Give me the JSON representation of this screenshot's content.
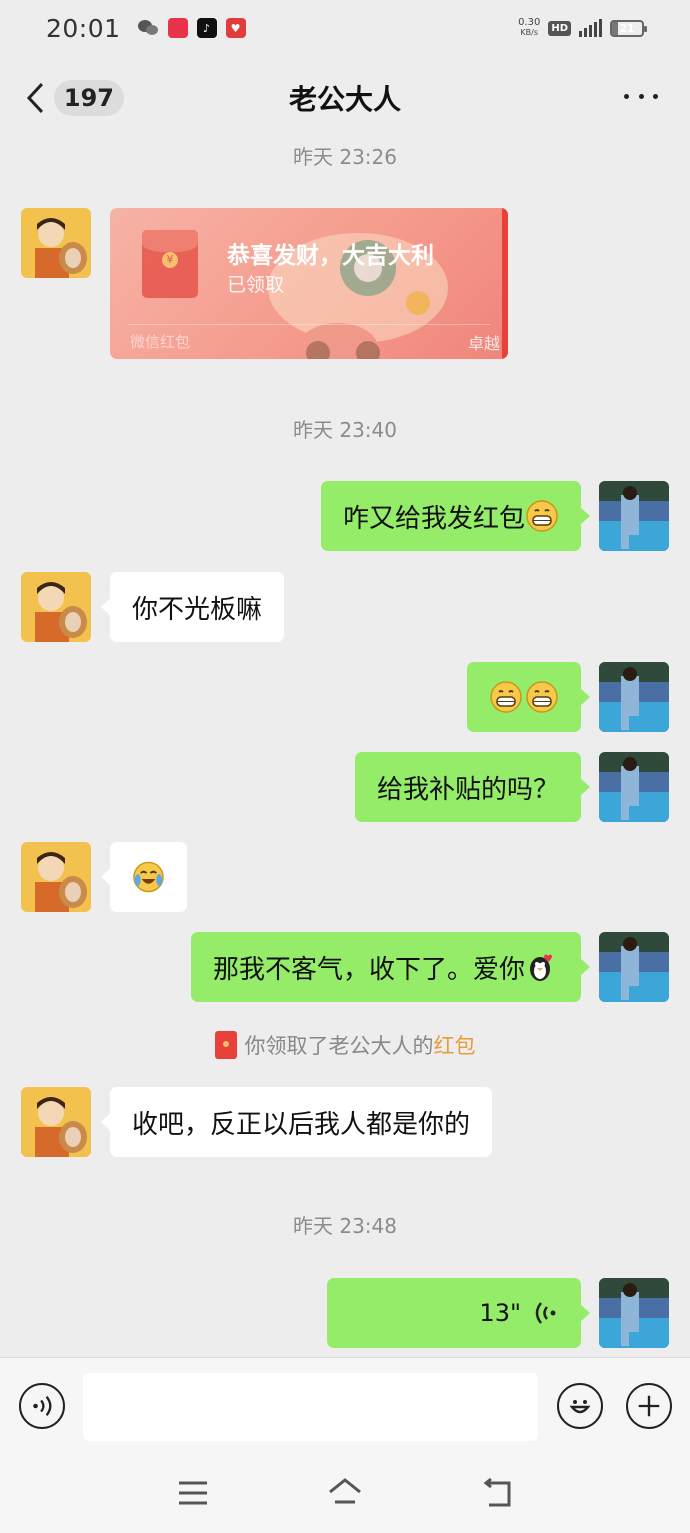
{
  "status_bar": {
    "time": "20:01",
    "network_speed": "0.30",
    "network_unit": "KB/s",
    "hd_label": "HD",
    "signal_label": "5G",
    "battery": "21"
  },
  "header": {
    "unread_count": "197",
    "title": "老公大人"
  },
  "timestamps": [
    "昨天 23:26",
    "昨天 23:40",
    "昨天 23:48"
  ],
  "red_packet": {
    "title": "恭喜发财，大吉大利",
    "status": "已领取",
    "footer_left": "微信红包",
    "footer_right": "卓越"
  },
  "messages": {
    "m1": "咋又给我发红包",
    "m2": "你不光板嘛",
    "m4": "给我补贴的吗？",
    "m6": "那我不客气，收下了。爱你",
    "m7": "收吧，反正以后我人都是你的"
  },
  "system_message": {
    "prefix": "你领取了老公大人的",
    "link": "红包"
  },
  "voice": {
    "duration": "13\""
  },
  "colors": {
    "sent_bubble": "#95ec69",
    "received_bubble": "#ffffff",
    "background": "#ededed",
    "red_packet_accent": "#e89b3a"
  }
}
